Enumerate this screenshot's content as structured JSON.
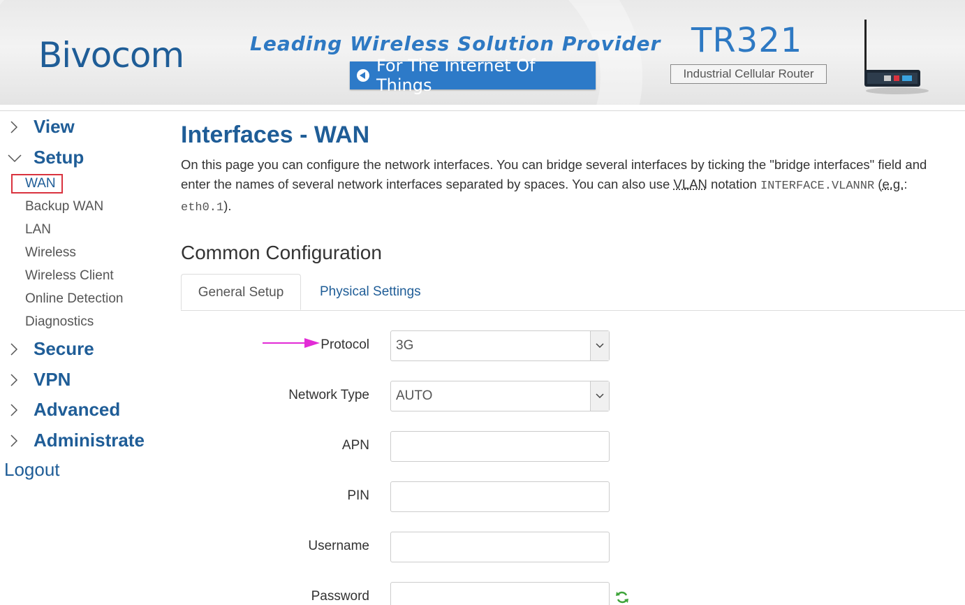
{
  "header": {
    "logo": "Bivocom",
    "tagline": "Leading Wireless Solution Provider",
    "iot_button": "For The Internet Of Things",
    "model": "TR321",
    "model_subtitle": "Industrial Cellular Router"
  },
  "sidebar": {
    "view": "View",
    "setup": "Setup",
    "setup_items": [
      "WAN",
      "Backup WAN",
      "LAN",
      "Wireless",
      "Wireless Client",
      "Online Detection",
      "Diagnostics"
    ],
    "secure": "Secure",
    "vpn": "VPN",
    "advanced": "Advanced",
    "administrate": "Administrate",
    "logout": "Logout"
  },
  "main": {
    "title": "Interfaces - WAN",
    "desc_line1": "On this page you can configure the network interfaces. You can bridge several interfaces by ticking the \"bridge interfaces\" field and",
    "desc_line2_a": "enter the names of several network interfaces separated by spaces. You can also use ",
    "desc_vlan": "VLAN",
    "desc_line2_b": " notation ",
    "desc_code1": "INTERFACE.VLANNR",
    "desc_line2_c": " (",
    "desc_eg": "e.g.",
    "desc_line2_d": ":",
    "desc_code2": "eth0.1",
    "desc_line3_end": ").",
    "section_title": "Common Configuration",
    "tabs": [
      "General Setup",
      "Physical Settings"
    ],
    "fields": {
      "protocol_label": "Protocol",
      "protocol_value": "3G",
      "network_type_label": "Network Type",
      "network_type_value": "AUTO",
      "apn_label": "APN",
      "apn_value": "",
      "pin_label": "PIN",
      "pin_value": "",
      "username_label": "Username",
      "username_value": "",
      "password_label": "Password",
      "password_value": ""
    }
  },
  "colors": {
    "brand_blue": "#1f5d97",
    "active_border": "#d9333f",
    "annotation_arrow": "#e22bd6"
  }
}
